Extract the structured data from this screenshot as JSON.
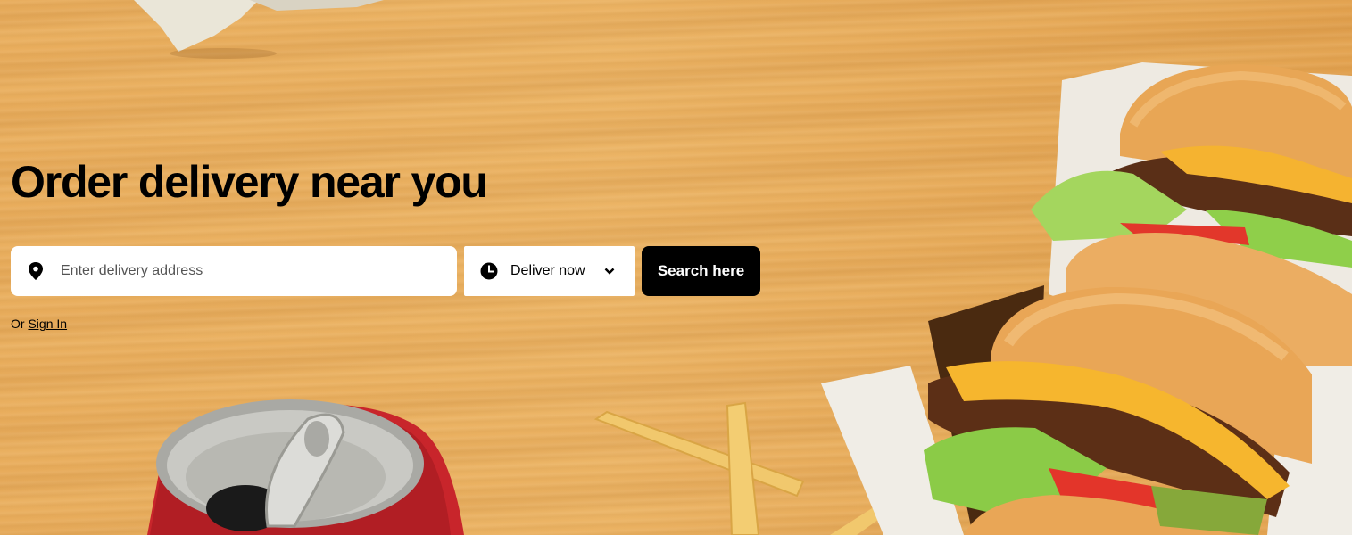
{
  "hero": {
    "headline": "Order delivery near you"
  },
  "search": {
    "address_placeholder": "Enter delivery address",
    "address_value": "",
    "pin_icon": "location-pin-icon",
    "clock_icon": "clock-icon",
    "deliver_option": "Deliver now",
    "chevron_icon": "chevron-down-icon",
    "submit_label": "Search here"
  },
  "auth": {
    "prefix": "Or",
    "signin_label": "Sign In"
  },
  "colors": {
    "background": "#e9ad5c",
    "button": "#000000",
    "button_text": "#ffffff",
    "field": "#ffffff"
  }
}
